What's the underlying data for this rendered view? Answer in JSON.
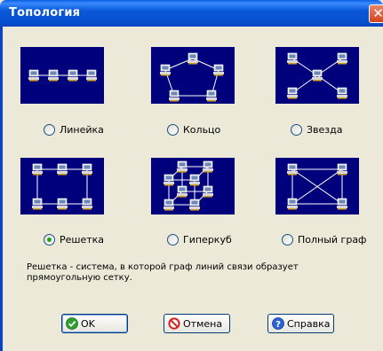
{
  "window": {
    "title": "Топология",
    "close_glyph": "✕"
  },
  "options": [
    {
      "label": "Линейка",
      "selected": false,
      "picture": "linear-topology-diagram"
    },
    {
      "label": "Кольцо",
      "selected": false,
      "picture": "ring-topology-diagram"
    },
    {
      "label": "Звезда",
      "selected": false,
      "picture": "star-topology-diagram"
    },
    {
      "label": "Решетка",
      "selected": true,
      "picture": "grid-topology-diagram"
    },
    {
      "label": "Гиперкуб",
      "selected": false,
      "picture": "hypercube-topology-diagram"
    },
    {
      "label": "Полный граф",
      "selected": false,
      "picture": "complete-graph-topology-diagram"
    }
  ],
  "description": "Решетка - система, в которой граф линий связи образует прямоугольную сетку.",
  "buttons": {
    "ok": "OK",
    "cancel": "Отмена",
    "help": "Справка"
  },
  "icons": {
    "ok": "green-check-icon",
    "cancel": "red-no-icon",
    "help": "blue-question-icon"
  },
  "colors": {
    "titlebar": "#0a58d8",
    "dialog_bg": "#ece9d8",
    "picture_bg": "#00007c",
    "radio_dot": "#21a121"
  }
}
